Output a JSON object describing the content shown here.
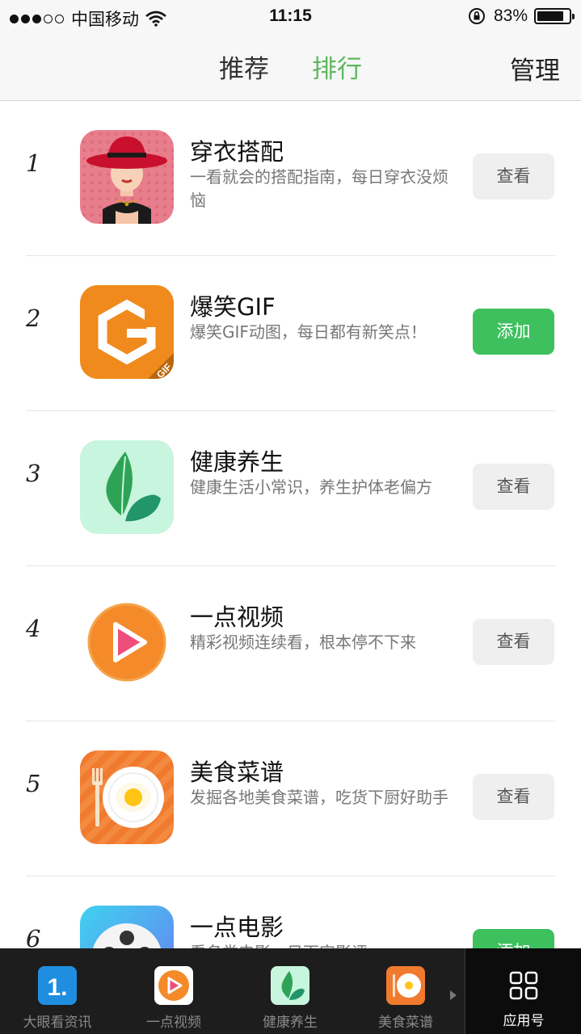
{
  "status_bar": {
    "carrier": "中国移动",
    "time": "11:15",
    "battery": "83%",
    "battery_level": 0.83,
    "signal_icon": "signal-dots-icon",
    "wifi_icon": "wifi-icon",
    "lock_icon": "orientation-lock-icon"
  },
  "nav": {
    "tabs": [
      {
        "label": "推荐",
        "active": false
      },
      {
        "label": "排行",
        "active": true
      }
    ],
    "manage_label": "管理",
    "active_color": "#5cb85c"
  },
  "list": [
    {
      "rank": "1",
      "name": "穿衣搭配",
      "desc": "一看就会的搭配指南，每日穿衣没烦恼",
      "button": "查看",
      "button_type": "view",
      "icon": "fashion-hat-icon"
    },
    {
      "rank": "2",
      "name": "爆笑GIF",
      "desc": "爆笑GIF动图，每日都有新笑点！",
      "button": "添加",
      "button_type": "add",
      "icon": "gif-g-icon",
      "icon_badge": "GIF"
    },
    {
      "rank": "3",
      "name": "健康养生",
      "desc": "健康生活小常识，养生护体老偏方",
      "button": "查看",
      "button_type": "view",
      "icon": "leaf-icon"
    },
    {
      "rank": "4",
      "name": "一点视频",
      "desc": "精彩视频连续看，根本停不下来",
      "button": "查看",
      "button_type": "view",
      "icon": "video-play-icon"
    },
    {
      "rank": "5",
      "name": "美食菜谱",
      "desc": "发掘各地美食菜谱，吃货下厨好助手",
      "button": "查看",
      "button_type": "view",
      "icon": "egg-plate-icon"
    },
    {
      "rank": "6",
      "name": "一点电影",
      "desc": "看名类电影，日下实影评",
      "button": "添加",
      "button_type": "add",
      "icon": "film-reel-icon"
    }
  ],
  "tabbar": {
    "items": [
      {
        "label": "大眼看资讯",
        "icon": "number-one-icon"
      },
      {
        "label": "一点视频",
        "icon": "video-play-icon"
      },
      {
        "label": "健康养生",
        "icon": "leaf-icon"
      },
      {
        "label": "美食菜谱",
        "icon": "egg-plate-icon"
      }
    ],
    "app_label": "应用号",
    "app_icon": "grid-icon"
  },
  "colors": {
    "add_button": "#3ec05e",
    "view_button": "#efefef",
    "tabbar_bg": "#1d1d1d"
  }
}
